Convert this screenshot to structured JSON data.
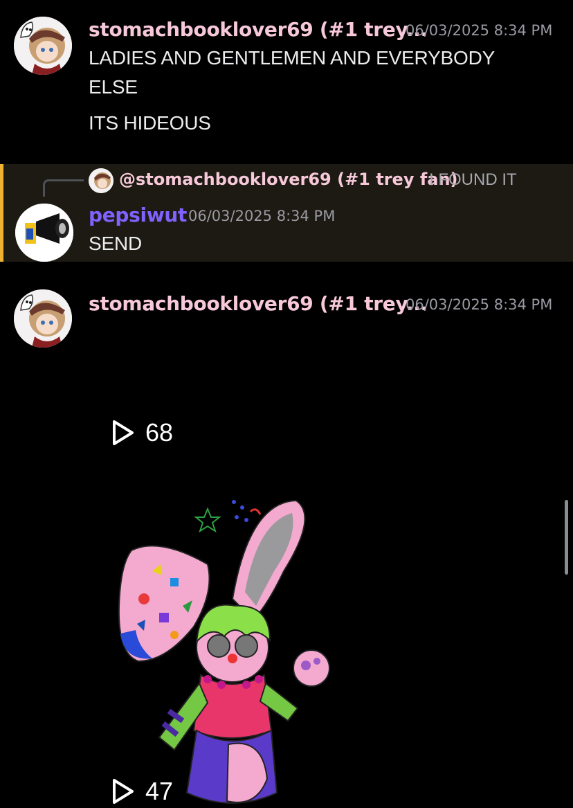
{
  "messages": [
    {
      "username": "stomachbooklover69 (#1 trey...",
      "timestamp": "06/03/2025 8:34 PM",
      "lines": [
        "LADIES AND GENTLEMEN AND EVERYBODY",
        "ELSE",
        "ITS HIDEOUS"
      ]
    },
    {
      "reply": {
        "mention": "@stomachbooklover69 (#1 trey fan)",
        "text": "I FOUND IT"
      },
      "username": "pepsiwut",
      "timestamp": "06/03/2025 8:34 PM",
      "lines": [
        "SEND"
      ]
    },
    {
      "username": "stomachbooklover69 (#1 trey...",
      "timestamp": "06/03/2025 8:34 PM"
    }
  ],
  "embed": {
    "view_counts": [
      "68",
      "47"
    ],
    "icon": "play-outline-icon"
  },
  "colors": {
    "background": "#000000",
    "username_pink": "#f6c8d9",
    "username_purple": "#7e63ff",
    "mention_highlight_bar": "#f0b232",
    "timestamp": "#9a9aa3"
  }
}
